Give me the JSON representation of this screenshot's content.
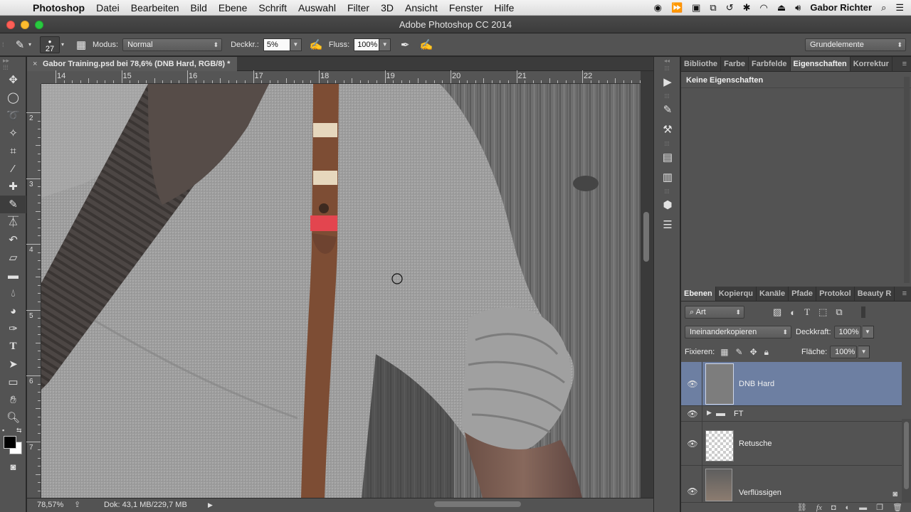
{
  "menubar": {
    "app": "Photoshop",
    "items": [
      "Datei",
      "Bearbeiten",
      "Bild",
      "Ebene",
      "Schrift",
      "Auswahl",
      "Filter",
      "3D",
      "Ansicht",
      "Fenster",
      "Hilfe"
    ],
    "user": "Gabor Richter"
  },
  "window": {
    "title": "Adobe Photoshop CC 2014"
  },
  "options": {
    "brush_size": "27",
    "mode_label": "Modus:",
    "mode_value": "Normal",
    "opacity_label": "Deckkr.:",
    "opacity_value": "5%",
    "flow_label": "Fluss:",
    "flow_value": "100%",
    "workspace": "Grundelemente"
  },
  "document": {
    "tab_title": "Gabor Training.psd bei 78,6% (DNB Hard, RGB/8) *",
    "ruler_h": [
      "14",
      "15",
      "16",
      "17",
      "18",
      "19",
      "20",
      "21",
      "22"
    ],
    "ruler_v": [
      "2",
      "3",
      "4",
      "5",
      "6",
      "7"
    ],
    "zoom": "78,57%",
    "doc_size": "Dok: 43,1 MB/229,7 MB"
  },
  "properties_panel": {
    "tabs": [
      "Bibliothe",
      "Farbe",
      "Farbfelde",
      "Eigenschaften",
      "Korrektur"
    ],
    "selected_tab": 3,
    "heading": "Keine Eigenschaften"
  },
  "layers_panel": {
    "tabs": [
      "Ebenen",
      "Kopierqu",
      "Kanäle",
      "Pfade",
      "Protokol",
      "Beauty R"
    ],
    "selected_tab": 0,
    "filter_value": "Art",
    "blend_mode": "Ineinanderkopieren",
    "opacity_label": "Deckkraft:",
    "opacity_value": "100%",
    "lock_label": "Fixieren:",
    "fill_label": "Fläche:",
    "fill_value": "100%",
    "layers": [
      {
        "name": "DNB Hard",
        "selected": true
      },
      {
        "name": "FT",
        "selected": false
      },
      {
        "name": "Retusche",
        "selected": false
      },
      {
        "name": "Verflüssigen",
        "selected": false
      }
    ]
  },
  "colors": {
    "selection": "#6d7fa2",
    "panel": "#535353"
  }
}
